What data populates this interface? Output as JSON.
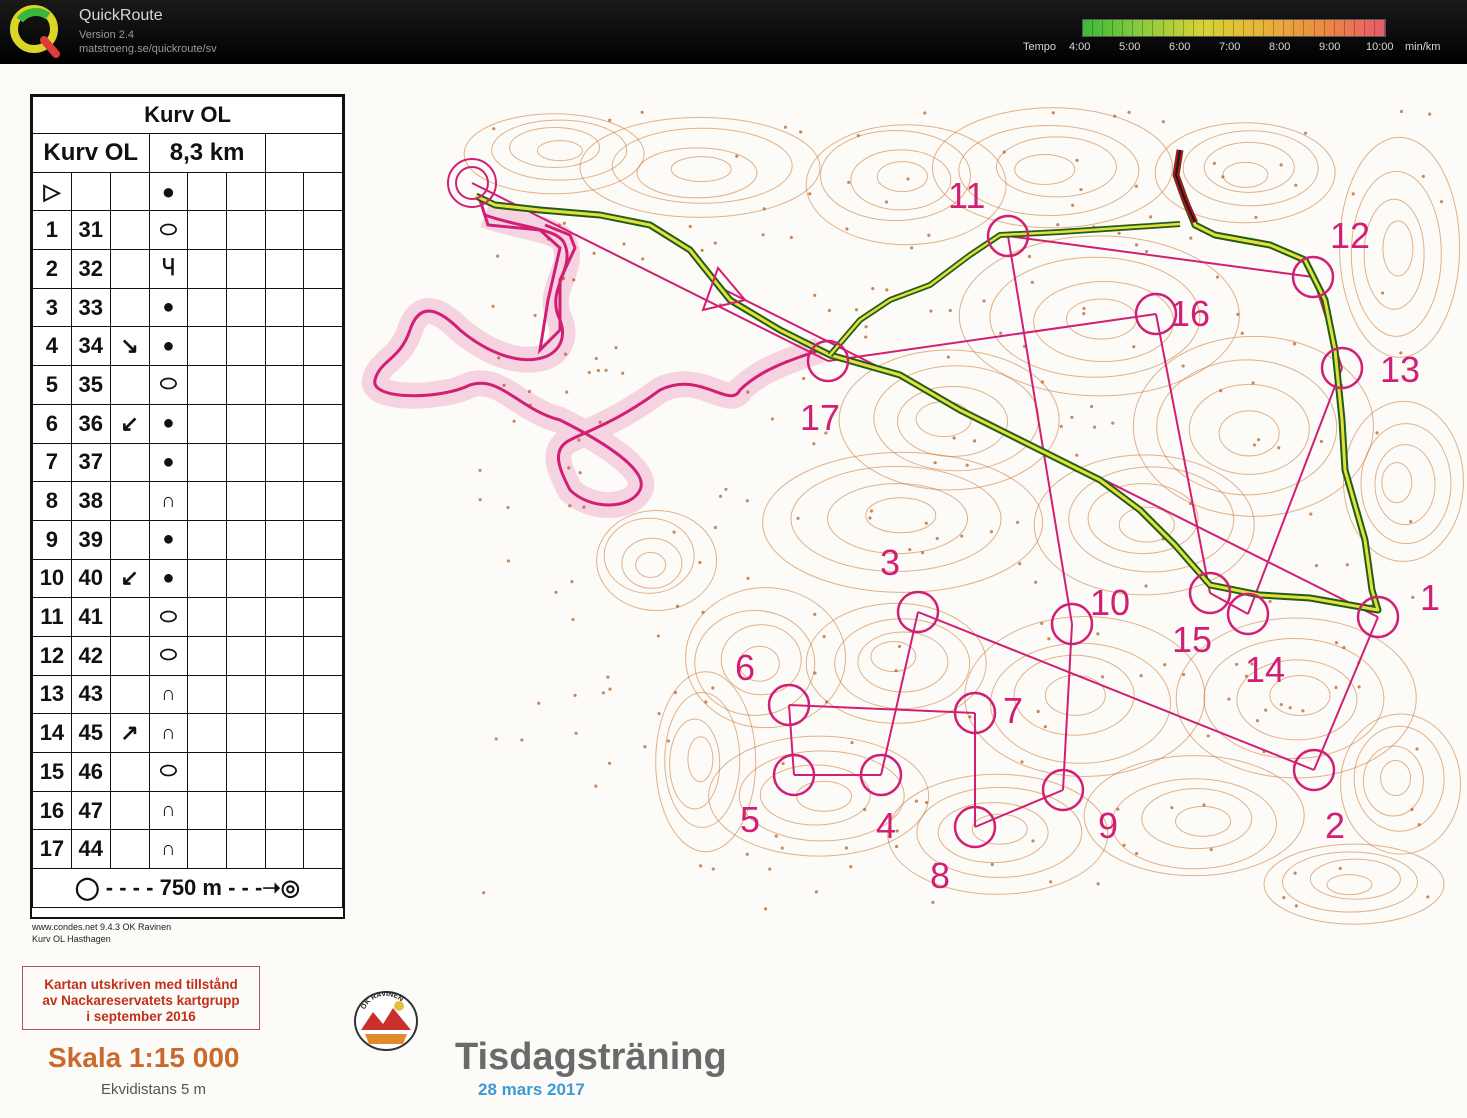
{
  "app": {
    "name": "QuickRoute",
    "version": "Version 2.4",
    "url": "matstroeng.se/quickroute/sv"
  },
  "tempo_scale": {
    "label": "Tempo",
    "ticks": [
      "4:00",
      "5:00",
      "6:00",
      "7:00",
      "8:00",
      "9:00",
      "10:00"
    ],
    "unit": "min/km",
    "colors": [
      "#3cb93c",
      "#8dcc3d",
      "#d6d236",
      "#e7b33a",
      "#ea8a45",
      "#e85a6a"
    ]
  },
  "colors": {
    "course": "#d01f74",
    "contour": "#c9742e",
    "route_dark": "#1f5e1a",
    "route_light": "#e6df3a",
    "route_end": "#b0101a"
  },
  "legend": {
    "event": "Kurv OL",
    "course": "Kurv OL",
    "length": "8,3 km",
    "start_symbol": "▷",
    "rows": [
      {
        "num": "1",
        "code": "31",
        "dir": "",
        "feat": "ellipse"
      },
      {
        "num": "2",
        "code": "32",
        "dir": "",
        "feat": "spur"
      },
      {
        "num": "3",
        "code": "33",
        "dir": "",
        "feat": "dot"
      },
      {
        "num": "4",
        "code": "34",
        "dir": "↘",
        "feat": "dot"
      },
      {
        "num": "5",
        "code": "35",
        "dir": "",
        "feat": "ellipse"
      },
      {
        "num": "6",
        "code": "36",
        "dir": "↙",
        "feat": "dot"
      },
      {
        "num": "7",
        "code": "37",
        "dir": "",
        "feat": "dot"
      },
      {
        "num": "8",
        "code": "38",
        "dir": "",
        "feat": "knoll"
      },
      {
        "num": "9",
        "code": "39",
        "dir": "",
        "feat": "dot"
      },
      {
        "num": "10",
        "code": "40",
        "dir": "↙",
        "feat": "dot"
      },
      {
        "num": "11",
        "code": "41",
        "dir": "",
        "feat": "ellipse"
      },
      {
        "num": "12",
        "code": "42",
        "dir": "",
        "feat": "ellipse"
      },
      {
        "num": "13",
        "code": "43",
        "dir": "",
        "feat": "knoll"
      },
      {
        "num": "14",
        "code": "45",
        "dir": "↗",
        "feat": "knoll"
      },
      {
        "num": "15",
        "code": "46",
        "dir": "",
        "feat": "ellipse"
      },
      {
        "num": "16",
        "code": "47",
        "dir": "",
        "feat": "knoll"
      },
      {
        "num": "17",
        "code": "44",
        "dir": "",
        "feat": "knoll"
      }
    ],
    "finish_distance": "750 m"
  },
  "credits": {
    "line1": "www.condes.net 9.4.3 OK Ravinen",
    "line2": "Kurv OL Hasthagen"
  },
  "permission": {
    "line1": "Kartan utskriven med tillstånd",
    "line2": "av Nackareservatets kartgrupp",
    "line3": "i september 2016"
  },
  "scale_text": "Skala 1:15 000",
  "equidistance": "Ekvidistans 5 m",
  "club_logo_text": "OK RAVINEN",
  "event_title": "Tisdagsträning",
  "event_date": "28 mars 2017",
  "controls": [
    {
      "label": "1"
    },
    {
      "label": "2"
    },
    {
      "label": "3"
    },
    {
      "label": "4"
    },
    {
      "label": "5"
    },
    {
      "label": "6"
    },
    {
      "label": "7"
    },
    {
      "label": "8"
    },
    {
      "label": "9"
    },
    {
      "label": "10"
    },
    {
      "label": "11"
    },
    {
      "label": "12"
    },
    {
      "label": "13"
    },
    {
      "label": "14"
    },
    {
      "label": "15"
    },
    {
      "label": "16"
    },
    {
      "label": "17"
    }
  ]
}
